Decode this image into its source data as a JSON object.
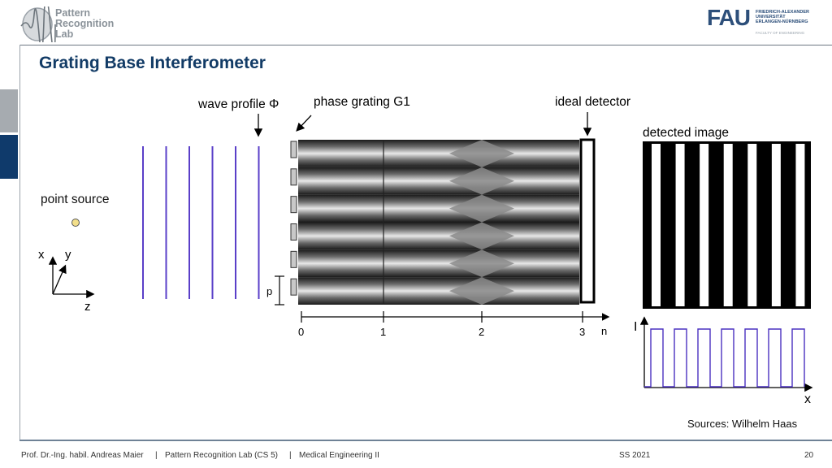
{
  "header": {
    "lab_logo": {
      "icon": "pattern-recognition-lab-logo",
      "lines": [
        "Pattern",
        "Recognition",
        "Lab"
      ]
    },
    "university_logo": {
      "icon": "fau-logo",
      "wordmark": "FAU",
      "lines": [
        "FRIEDRICH-ALEXANDER",
        "UNIVERSITÄT",
        "ERLANGEN-NÜRNBERG"
      ],
      "faculty": "FACULTY OF ENGINEERING"
    },
    "title": "Grating Base Interferometer"
  },
  "colors": {
    "title": "#123b66",
    "side_tab_active": "#0f3a6b",
    "side_tab_inactive": "#a6abb0",
    "wave_lines": "#5a3fc8",
    "source_dot": "#f3df8a"
  },
  "diagram": {
    "labels": {
      "point_source": "point source",
      "wave_profile": "wave profile Φ",
      "phase_grating": "phase grating G1",
      "ideal_detector": "ideal detector",
      "detected_image": "detected image",
      "period": "p"
    },
    "axes_3d": {
      "x": "x",
      "y": "y",
      "z": "z"
    },
    "wavefront_count": 6,
    "grating_element_count": 6,
    "propagation_axis": {
      "label": "n",
      "ticks": [
        "0",
        "1",
        "2",
        "3"
      ]
    },
    "detected_image_stripes": 7,
    "intensity_plot": {
      "y_label": "I",
      "x_label": "x",
      "pulses": 7
    }
  },
  "source_note": "Sources: Wilhelm Haas",
  "footer": {
    "author": "Prof. Dr.-Ing. habil. Andreas Maier",
    "sep1": "|",
    "lab": "Pattern Recognition Lab (CS 5)",
    "sep2": "|",
    "course": "Medical Engineering II",
    "semester": "SS 2021",
    "page": "20"
  }
}
